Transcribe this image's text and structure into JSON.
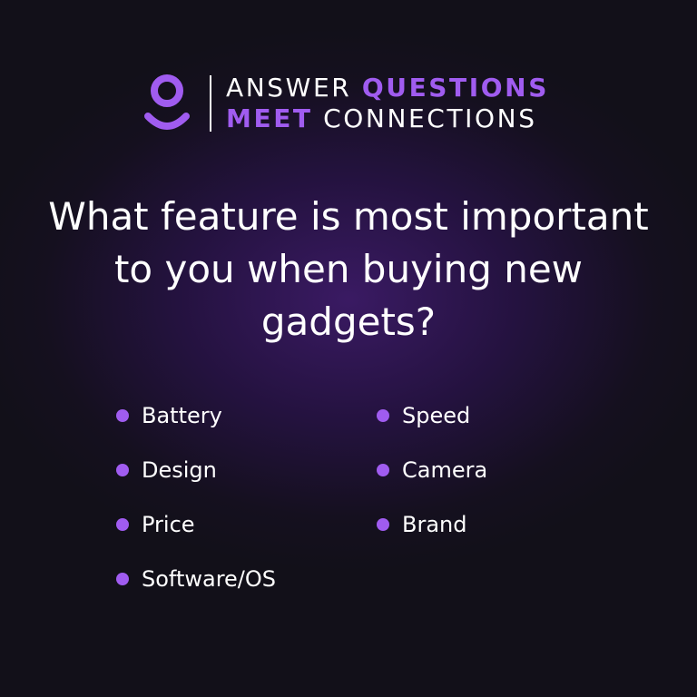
{
  "logo": {
    "icon": "person-icon",
    "line1": {
      "light": "ANSWER",
      "accent": "QUESTIONS"
    },
    "line2": {
      "accent": "MEET",
      "light": "CONNECTIONS"
    }
  },
  "question": {
    "line1": "What feature is most important",
    "line2": "to you when buying new",
    "line3": "gadgets?"
  },
  "options": {
    "left": [
      "Battery",
      "Design",
      "Price",
      "Software/OS"
    ],
    "right": [
      "Speed",
      "Camera",
      "Brand"
    ]
  },
  "colors": {
    "accent": "#a05cf0",
    "text": "#ffffff",
    "background": "#15101f",
    "glow": "#3a1a63"
  }
}
